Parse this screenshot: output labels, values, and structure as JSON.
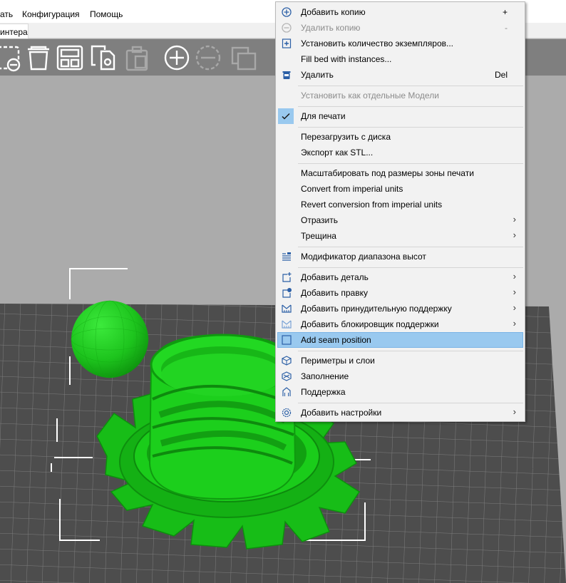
{
  "menubar": {
    "items": [
      "ать",
      "Конфигурация",
      "Помощь"
    ]
  },
  "tab": {
    "label": "интера"
  },
  "context_menu": {
    "items": [
      {
        "label": "Добавить копию",
        "shortcut": "+",
        "icon": "plus-circle-icon"
      },
      {
        "label": "Удалить копию",
        "shortcut": "-",
        "icon": "minus-circle-icon",
        "disabled": true
      },
      {
        "label": "Установить количество экземпляров...",
        "icon": "instances-icon"
      },
      {
        "label": "Fill bed with instances..."
      },
      {
        "label": "Удалить",
        "shortcut": "Del",
        "icon": "trash-icon"
      },
      {
        "label": "Установить как отдельные Модели",
        "disabled": true
      },
      {
        "label": "Для печати",
        "icon": "checkmark-icon",
        "checked": true
      },
      {
        "label": "Перезагрузить с диска"
      },
      {
        "label": "Экспорт как STL..."
      },
      {
        "label": "Масштабировать под размеры зоны печати"
      },
      {
        "label": "Convert from imperial units"
      },
      {
        "label": "Revert conversion from imperial units"
      },
      {
        "label": "Отразить",
        "submenu": true
      },
      {
        "label": "Трещина",
        "submenu": true
      },
      {
        "label": "Модификатор диапазона высот",
        "icon": "layers-icon"
      },
      {
        "label": "Добавить деталь",
        "icon": "add-part-icon",
        "submenu": true
      },
      {
        "label": "Добавить правку",
        "icon": "add-modifier-icon",
        "submenu": true
      },
      {
        "label": "Добавить принудительную поддержку",
        "icon": "support-enforcer-icon",
        "submenu": true
      },
      {
        "label": "Добавить блокировщик поддержки",
        "icon": "support-blocker-icon",
        "submenu": true
      },
      {
        "label": "Add seam position",
        "icon": "seam-icon",
        "highlighted": true
      },
      {
        "label": "Периметры и слои",
        "icon": "perimeters-icon"
      },
      {
        "label": "Заполнение",
        "icon": "infill-icon"
      },
      {
        "label": "Поддержка",
        "icon": "support-icon"
      },
      {
        "label": "Добавить настройки",
        "icon": "settings-gear-icon",
        "submenu": true
      }
    ]
  },
  "colors": {
    "model_green": "#19c419",
    "bed": "#4b4b4b",
    "toolbar": "#7f7f7f",
    "background": "#ababab",
    "highlight": "#99c9ef"
  },
  "submenu_arrow": "›"
}
